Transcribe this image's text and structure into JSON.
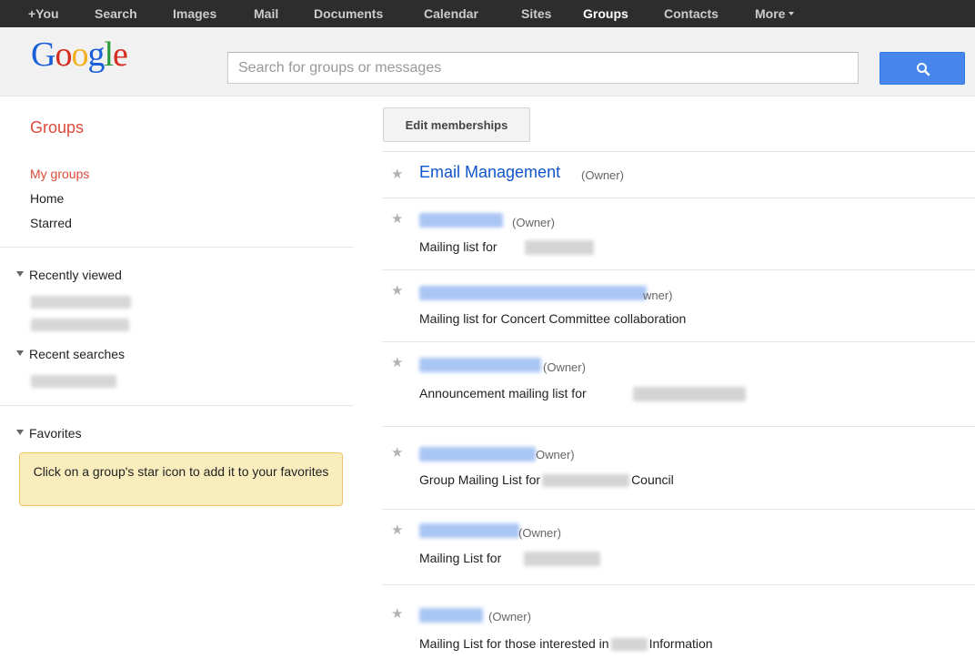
{
  "topnav": {
    "items": [
      "+You",
      "Search",
      "Images",
      "Mail",
      "Documents",
      "Calendar",
      "Sites",
      "Groups",
      "Contacts",
      "More"
    ],
    "active": "Groups"
  },
  "header": {
    "logo": [
      "G",
      "o",
      "o",
      "g",
      "l",
      "e"
    ],
    "search_placeholder": "Search for groups or messages",
    "search_value": "",
    "search_icon": "magnifier-icon"
  },
  "sidebar": {
    "title": "Groups",
    "nav": [
      "My groups",
      "Home",
      "Starred"
    ],
    "selected": "My groups",
    "recently_viewed": "Recently viewed",
    "recent_searches": "Recent searches",
    "favorites": "Favorites",
    "favorites_hint": "Click on a group's star icon to add it to your favorites"
  },
  "main": {
    "edit_button": "Edit memberships",
    "owner_tag": "(Owner)",
    "first_group_name": "Email Management",
    "descriptions": {
      "d1": "Mailing list for",
      "d2": "Mailing list for Concert Committee collaboration",
      "d3": "Announcement mailing list for",
      "d4a": "Group Mailing List for",
      "d4b": "Council",
      "d5": "Mailing List for",
      "d6a": "Mailing List for those interested in",
      "d6b": "Information"
    }
  },
  "colors": {
    "topbar": "#2d2d2d",
    "accent_red": "#dd4b39",
    "link_blue": "#1155cc",
    "search_blue": "#4787ed",
    "hint_yellow": "#f9edbe"
  }
}
